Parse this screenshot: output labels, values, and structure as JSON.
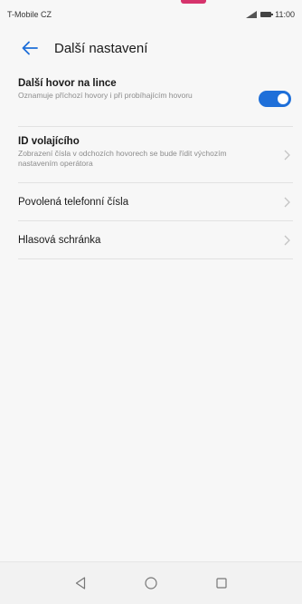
{
  "status_bar": {
    "carrier": "T-Mobile CZ",
    "time": "11:00"
  },
  "header": {
    "title": "Další nastavení"
  },
  "items": [
    {
      "title": "Další hovor na lince",
      "subtitle": "Oznamuje příchozí hovory i při probíhajícím hovoru",
      "control": "toggle",
      "enabled": true
    },
    {
      "title": "ID volajícího",
      "subtitle": "Zobrazení čísla v odchozích hovorech se bude řídit výchozím nastavením operátora",
      "control": "chevron"
    },
    {
      "title": "Povolená telefonní čísla",
      "subtitle": "",
      "control": "chevron"
    },
    {
      "title": "Hlasová schránka",
      "subtitle": "",
      "control": "chevron"
    }
  ],
  "colors": {
    "accent": "#1e6fd9",
    "background": "#f7f7f7",
    "notification_mark": "#d6336c"
  },
  "icons": [
    "back-arrow-icon",
    "chevron-right-icon",
    "nav-back-icon",
    "nav-home-icon",
    "nav-recents-icon"
  ]
}
